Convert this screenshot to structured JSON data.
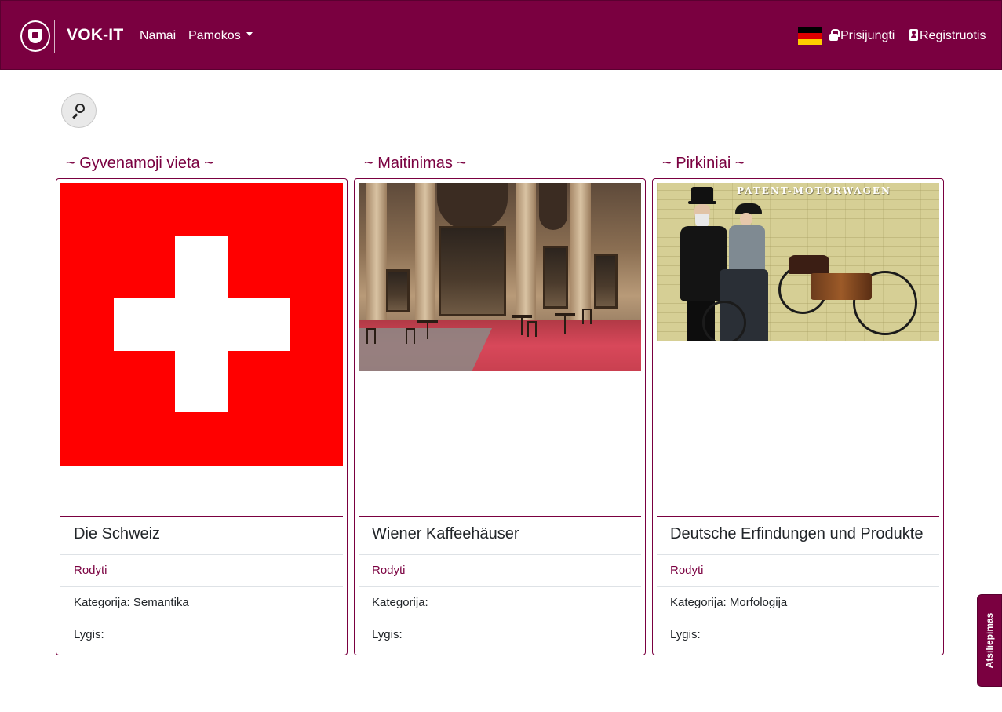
{
  "navbar": {
    "brand": "VOK-IT",
    "home": "Namai",
    "lessons": "Pamokos",
    "login": "Prisijungti",
    "register": "Registruotis",
    "language_flag": "german-flag",
    "accent_color": "#7a0040"
  },
  "search": {
    "icon": "search-icon"
  },
  "cards": [
    {
      "category_heading": "~ Gyvenamoji vieta ~",
      "image": "swiss-flag",
      "title": "Die Schweiz",
      "link": "Rodyti",
      "category": "Kategorija: Semantika",
      "level": "Lygis:"
    },
    {
      "category_heading": "~ Maitinimas ~",
      "image": "vienna-cafe-photo",
      "title": "Wiener Kaffeehäuser",
      "link": "Rodyti",
      "category": "Kategorija:",
      "level": "Lygis:"
    },
    {
      "category_heading": "~ Pirkiniai ~",
      "image": "patent-motorwagen-photo",
      "image_caption": "PATENT-MOTORWAGEN",
      "title": "Deutsche Erfindungen und Produkte",
      "link": "Rodyti",
      "category": "Kategorija: Morfologija",
      "level": "Lygis:"
    }
  ],
  "feedback": {
    "label": "Atsiliepimas"
  }
}
